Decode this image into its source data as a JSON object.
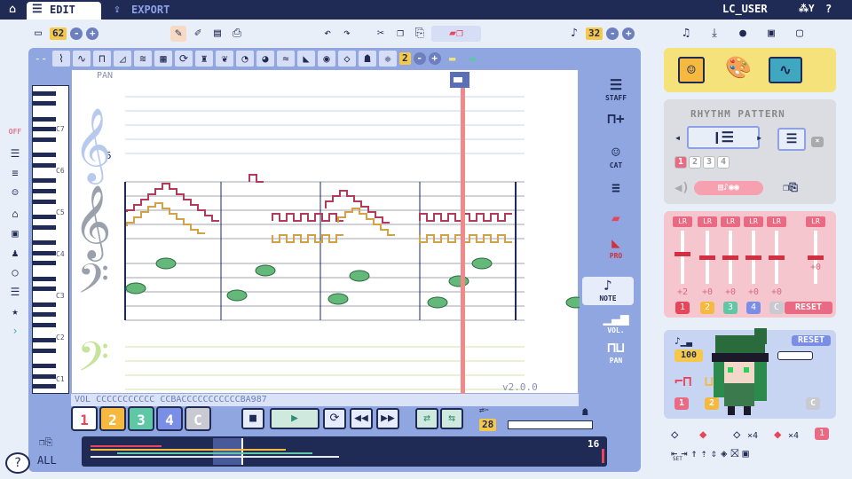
{
  "topbar": {
    "tabs": [
      {
        "label": "EDIT",
        "icon": "list-icon"
      },
      {
        "label": "EXPORT",
        "icon": "export-icon"
      }
    ],
    "user": "LC_USER",
    "signal": "⁂Y",
    "help": "?"
  },
  "toolbar": {
    "file_count": "62",
    "page_number": "32"
  },
  "tracks_row": {
    "value": "2"
  },
  "staff": {
    "label": "PAN",
    "measure_label": "5",
    "pitch_labels": [
      "C7",
      "C6",
      "C5",
      "C4",
      "C3",
      "C2",
      "C1"
    ]
  },
  "note_row": "VOL CCCCCCCCCCC CCBACCCCCCCCCCCBA987",
  "version": "v2.0.0",
  "right_side": {
    "staff": "STAFF",
    "cat": "CAT",
    "pro": "PRO",
    "note": "NOTE",
    "vol": "VOL.",
    "pan": "PAN"
  },
  "transport": {
    "tracks": [
      "1",
      "2",
      "3",
      "4",
      "C"
    ],
    "speed": "28",
    "bar_count": "16"
  },
  "rhythm_panel": {
    "title": "RHYTHM PATTERN",
    "numbers": [
      "1",
      "2",
      "3",
      "4"
    ]
  },
  "mixer": {
    "lr_labels": [
      "LR",
      "LR",
      "LR",
      "LR",
      "LR",
      "LR"
    ],
    "values": [
      "+2",
      "+0",
      "+0",
      "+0",
      "+0",
      "+0"
    ],
    "channel_labels": [
      "1",
      "2",
      "3",
      "4",
      "C"
    ],
    "reset": "RESET"
  },
  "instrument_panel": {
    "reset": "RESET",
    "volume": "100",
    "labels": [
      "1",
      "2",
      "C"
    ]
  },
  "bottom_icons": {
    "x4a": "×4",
    "x4b": "×4",
    "set": "SET",
    "one": "1"
  },
  "left_bar": {
    "off": "OFF"
  },
  "all_label": "ALL",
  "colors": {
    "navy": "#1f2a55",
    "track1": "#e8455a",
    "track2": "#f5b93f",
    "track3": "#5fc6a6",
    "track4": "#7b8ee6",
    "trackC": "#c9c9d1",
    "playhead": "#f08a8a",
    "melody_red": "#b23a5a",
    "melody_orange": "#d3a246",
    "bass_green": "#63b87a"
  }
}
